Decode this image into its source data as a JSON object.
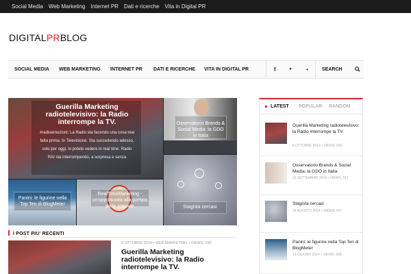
{
  "topbar": {
    "items": [
      "Social Media",
      "Web Marketing",
      "Internet PR",
      "Dati e ricerche",
      "Vita in Digital PR"
    ]
  },
  "logo": {
    "part1": "DIGITAL",
    "part2": "PR",
    "part3": "BLOG"
  },
  "nav": {
    "items": [
      "SOCIAL MEDIA",
      "WEB MARKETING",
      "INTERNET PR",
      "DATI E RICERCHE",
      "VITA IN DIGITAL PR"
    ],
    "facebook_icon": "f",
    "twitter_icon": "🐦",
    "plus_icon": "+",
    "search_label": "SEARCH",
    "search_icon": "search-icon"
  },
  "featured": {
    "main": {
      "title": "Guerilla Marketing radiotelevisivo: la Radio interrompe la TV.",
      "excerpt": "#radioemozioni: La Radio sta facendo una cosa mai fatta prima. In Televisione. Sta succedendo adesso, solo per oggi, lo potete vedere in real time. Radio RAI sta interrompendo, a sorpresa e senza"
    },
    "tile2": "Osservatorio Brands & Social Media: la GDO in Italia",
    "tile3": "Stagista cercasi",
    "tile4": "Panini: le figurine nella Top Ten di BlogMeter",
    "tile5": "RealTimeMarketing - un'opportunità alla portata delle aziende"
  },
  "recent": {
    "section_title": "I POST PIU' RECENTI",
    "meta": "6 OTTOBRE 2014 • WEB MARKETING • VIEWS: 249",
    "title": "Guerilla Marketing radiotelevisivo: la Radio interrompe la TV."
  },
  "sidebar": {
    "tabs": [
      "LATEST",
      "POPULAR",
      "RANDOM"
    ],
    "items": [
      {
        "title": "Guerilla Marketing radiotelevisivo: la Radio interrompe la TV.",
        "meta": "6 OTTOBRE 2014 • VIEWS: 249"
      },
      {
        "title": "Osservatorio Brands & Social Media: la GDO in Italia",
        "meta": "23 SETTEMBRE 2014 • VIEWS: 517"
      },
      {
        "title": "Stagista cercasi",
        "meta": "18 AGOSTO 2014 • VIEWS: 667"
      },
      {
        "title": "Panini: le figurine nella Top Ten di BlogMeter",
        "meta": "13 GIUGNO 2014 • VIEWS: 969"
      }
    ]
  },
  "colors": {
    "accent": "#d7262b",
    "topbar": "#1b1b1b"
  }
}
